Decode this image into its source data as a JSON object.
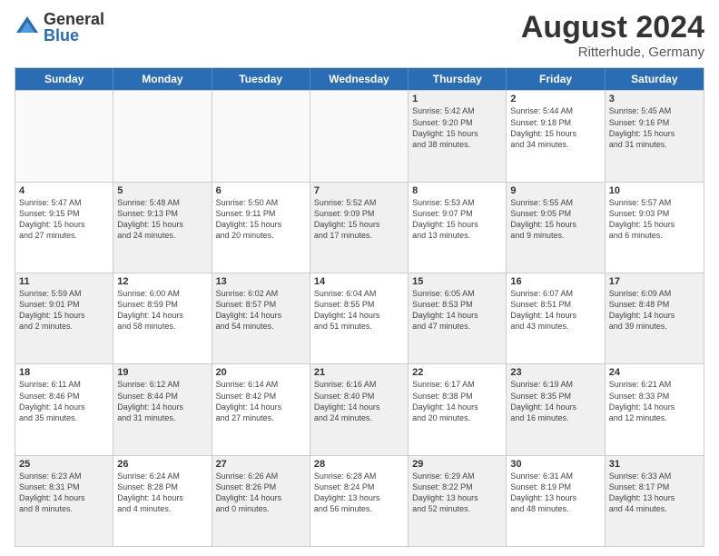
{
  "logo": {
    "general": "General",
    "blue": "Blue"
  },
  "title": "August 2024",
  "subtitle": "Ritterhude, Germany",
  "days": [
    "Sunday",
    "Monday",
    "Tuesday",
    "Wednesday",
    "Thursday",
    "Friday",
    "Saturday"
  ],
  "rows": [
    [
      {
        "day": "",
        "text": "",
        "empty": true
      },
      {
        "day": "",
        "text": "",
        "empty": true
      },
      {
        "day": "",
        "text": "",
        "empty": true
      },
      {
        "day": "",
        "text": "",
        "empty": true
      },
      {
        "day": "1",
        "text": "Sunrise: 5:42 AM\nSunset: 9:20 PM\nDaylight: 15 hours\nand 38 minutes.",
        "shaded": true
      },
      {
        "day": "2",
        "text": "Sunrise: 5:44 AM\nSunset: 9:18 PM\nDaylight: 15 hours\nand 34 minutes.",
        "shaded": false
      },
      {
        "day": "3",
        "text": "Sunrise: 5:45 AM\nSunset: 9:16 PM\nDaylight: 15 hours\nand 31 minutes.",
        "shaded": true
      }
    ],
    [
      {
        "day": "4",
        "text": "Sunrise: 5:47 AM\nSunset: 9:15 PM\nDaylight: 15 hours\nand 27 minutes.",
        "shaded": false
      },
      {
        "day": "5",
        "text": "Sunrise: 5:48 AM\nSunset: 9:13 PM\nDaylight: 15 hours\nand 24 minutes.",
        "shaded": true
      },
      {
        "day": "6",
        "text": "Sunrise: 5:50 AM\nSunset: 9:11 PM\nDaylight: 15 hours\nand 20 minutes.",
        "shaded": false
      },
      {
        "day": "7",
        "text": "Sunrise: 5:52 AM\nSunset: 9:09 PM\nDaylight: 15 hours\nand 17 minutes.",
        "shaded": true
      },
      {
        "day": "8",
        "text": "Sunrise: 5:53 AM\nSunset: 9:07 PM\nDaylight: 15 hours\nand 13 minutes.",
        "shaded": false
      },
      {
        "day": "9",
        "text": "Sunrise: 5:55 AM\nSunset: 9:05 PM\nDaylight: 15 hours\nand 9 minutes.",
        "shaded": true
      },
      {
        "day": "10",
        "text": "Sunrise: 5:57 AM\nSunset: 9:03 PM\nDaylight: 15 hours\nand 6 minutes.",
        "shaded": false
      }
    ],
    [
      {
        "day": "11",
        "text": "Sunrise: 5:59 AM\nSunset: 9:01 PM\nDaylight: 15 hours\nand 2 minutes.",
        "shaded": true
      },
      {
        "day": "12",
        "text": "Sunrise: 6:00 AM\nSunset: 8:59 PM\nDaylight: 14 hours\nand 58 minutes.",
        "shaded": false
      },
      {
        "day": "13",
        "text": "Sunrise: 6:02 AM\nSunset: 8:57 PM\nDaylight: 14 hours\nand 54 minutes.",
        "shaded": true
      },
      {
        "day": "14",
        "text": "Sunrise: 6:04 AM\nSunset: 8:55 PM\nDaylight: 14 hours\nand 51 minutes.",
        "shaded": false
      },
      {
        "day": "15",
        "text": "Sunrise: 6:05 AM\nSunset: 8:53 PM\nDaylight: 14 hours\nand 47 minutes.",
        "shaded": true
      },
      {
        "day": "16",
        "text": "Sunrise: 6:07 AM\nSunset: 8:51 PM\nDaylight: 14 hours\nand 43 minutes.",
        "shaded": false
      },
      {
        "day": "17",
        "text": "Sunrise: 6:09 AM\nSunset: 8:48 PM\nDaylight: 14 hours\nand 39 minutes.",
        "shaded": true
      }
    ],
    [
      {
        "day": "18",
        "text": "Sunrise: 6:11 AM\nSunset: 8:46 PM\nDaylight: 14 hours\nand 35 minutes.",
        "shaded": false
      },
      {
        "day": "19",
        "text": "Sunrise: 6:12 AM\nSunset: 8:44 PM\nDaylight: 14 hours\nand 31 minutes.",
        "shaded": true
      },
      {
        "day": "20",
        "text": "Sunrise: 6:14 AM\nSunset: 8:42 PM\nDaylight: 14 hours\nand 27 minutes.",
        "shaded": false
      },
      {
        "day": "21",
        "text": "Sunrise: 6:16 AM\nSunset: 8:40 PM\nDaylight: 14 hours\nand 24 minutes.",
        "shaded": true
      },
      {
        "day": "22",
        "text": "Sunrise: 6:17 AM\nSunset: 8:38 PM\nDaylight: 14 hours\nand 20 minutes.",
        "shaded": false
      },
      {
        "day": "23",
        "text": "Sunrise: 6:19 AM\nSunset: 8:35 PM\nDaylight: 14 hours\nand 16 minutes.",
        "shaded": true
      },
      {
        "day": "24",
        "text": "Sunrise: 6:21 AM\nSunset: 8:33 PM\nDaylight: 14 hours\nand 12 minutes.",
        "shaded": false
      }
    ],
    [
      {
        "day": "25",
        "text": "Sunrise: 6:23 AM\nSunset: 8:31 PM\nDaylight: 14 hours\nand 8 minutes.",
        "shaded": true
      },
      {
        "day": "26",
        "text": "Sunrise: 6:24 AM\nSunset: 8:28 PM\nDaylight: 14 hours\nand 4 minutes.",
        "shaded": false
      },
      {
        "day": "27",
        "text": "Sunrise: 6:26 AM\nSunset: 8:26 PM\nDaylight: 14 hours\nand 0 minutes.",
        "shaded": true
      },
      {
        "day": "28",
        "text": "Sunrise: 6:28 AM\nSunset: 8:24 PM\nDaylight: 13 hours\nand 56 minutes.",
        "shaded": false
      },
      {
        "day": "29",
        "text": "Sunrise: 6:29 AM\nSunset: 8:22 PM\nDaylight: 13 hours\nand 52 minutes.",
        "shaded": true
      },
      {
        "day": "30",
        "text": "Sunrise: 6:31 AM\nSunset: 8:19 PM\nDaylight: 13 hours\nand 48 minutes.",
        "shaded": false
      },
      {
        "day": "31",
        "text": "Sunrise: 6:33 AM\nSunset: 8:17 PM\nDaylight: 13 hours\nand 44 minutes.",
        "shaded": true
      }
    ]
  ]
}
